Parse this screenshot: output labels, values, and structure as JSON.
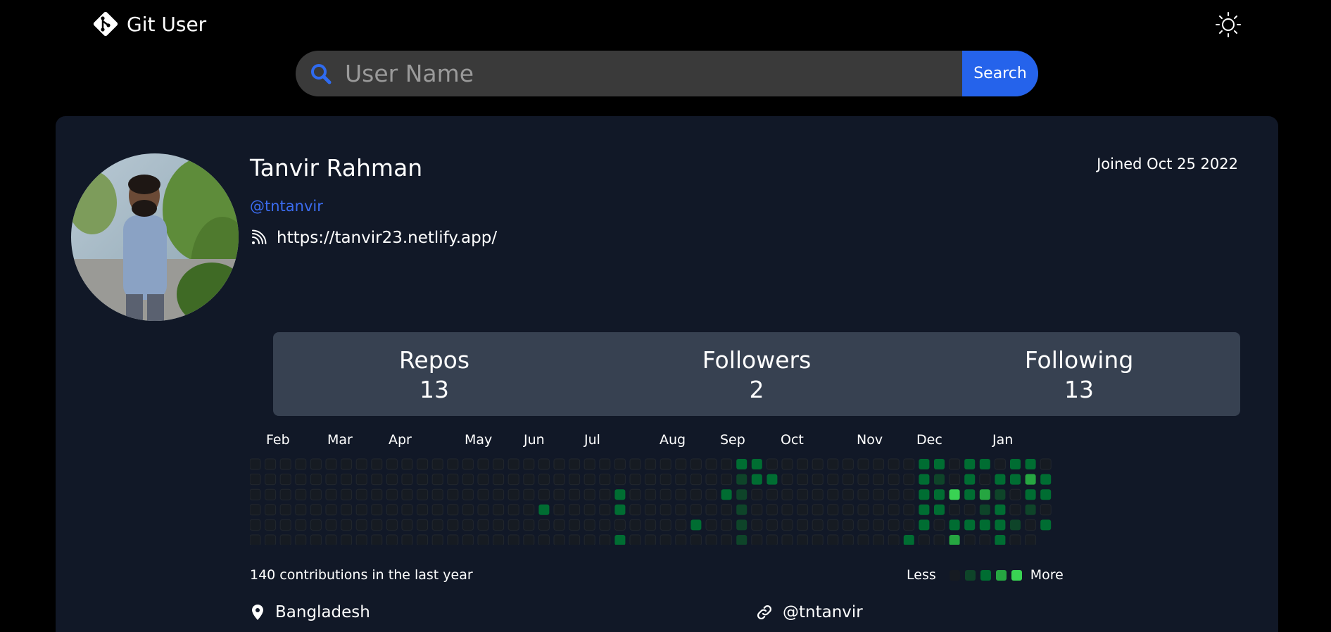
{
  "header": {
    "brand_label": "Git User",
    "brand_icon": "git-logo-icon",
    "theme_icon": "sun-icon"
  },
  "search": {
    "placeholder": "User Name",
    "value": "",
    "button_label": "Search",
    "icon": "search-icon",
    "accent": "#2563eb"
  },
  "profile": {
    "name": "Tanvir Rahman",
    "handle": "@tntanvir",
    "joined": "Joined Oct 25 2022",
    "blog": "https://tanvir23.netlify.app/",
    "location": "Bangladesh",
    "twitter": "@tntanvir"
  },
  "stats": [
    {
      "label": "Repos",
      "value": "13"
    },
    {
      "label": "Followers",
      "value": "2"
    },
    {
      "label": "Following",
      "value": "13"
    }
  ],
  "contributions": {
    "months": [
      "Feb",
      "Mar",
      "Apr",
      "May",
      "Jun",
      "Jul",
      "Aug",
      "Sep",
      "Oct",
      "Nov",
      "Dec",
      "Jan"
    ],
    "total_text": "140 contributions in the last year",
    "legend_less": "Less",
    "legend_more": "More",
    "level_colors": [
      "#161b22",
      "#0e4429",
      "#006d32",
      "#26a641",
      "#39d353"
    ]
  }
}
